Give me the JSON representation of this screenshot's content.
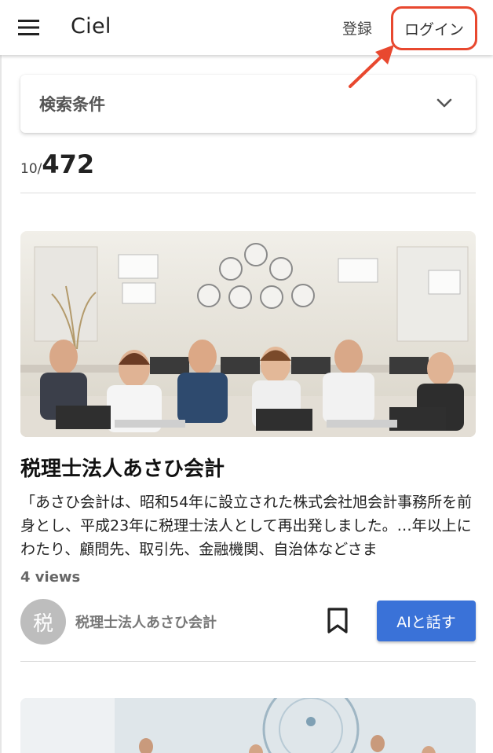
{
  "appbar": {
    "title": "Ciel",
    "menu_icon": "hamburger-menu-icon",
    "register_label": "登録",
    "login_label": "ログイン",
    "highlight_color": "#e8482f"
  },
  "search": {
    "label": "検索条件",
    "expand_icon": "chevron-down-icon"
  },
  "results": {
    "shown": "10/",
    "total": "472"
  },
  "card": {
    "image": "office-workers-at-laptops-illustration",
    "title": "税理士法人あさひ会計",
    "description": "「あさひ会計は、昭和54年に設立された株式会社旭会計事務所を前身とし、平成23年に税理士法人として再出発しました。…年以上にわたり、顧問先、取引先、金融機関、自治体などさま",
    "views": "4 views",
    "avatar_letter": "税",
    "org_name": "税理士法人あさひ会計",
    "bookmark_icon": "bookmark-icon",
    "ai_button_label": "AIと話す",
    "ai_button_color": "#3a72d8"
  },
  "next_card": {
    "image": "futuristic-office-illustration"
  }
}
